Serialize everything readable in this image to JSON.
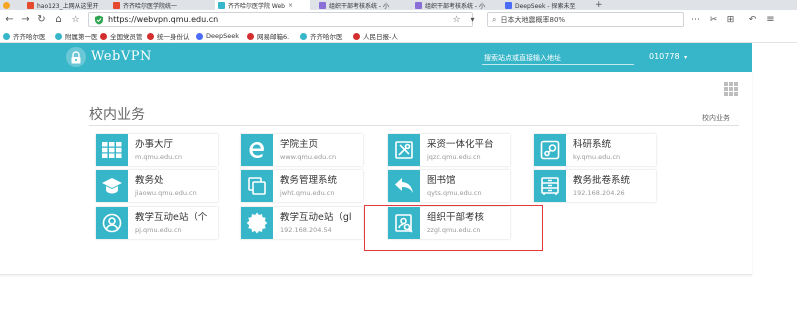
{
  "tabs": [
    {
      "label": "hao123_上网从这里开",
      "color": "#e64a2e"
    },
    {
      "label": "齐齐哈尔医学院统一",
      "color": "#e64a2e"
    },
    {
      "label": "齐齐哈尔医学院 Web",
      "color": "#38b6c9"
    },
    {
      "label": "组织干部考核系统 - 小",
      "color": "#8a6fd8"
    },
    {
      "label": "组织干部考核系统 - 小",
      "color": "#8a6fd8"
    },
    {
      "label": "DeepSeek - 探索未至",
      "color": "#4a6cf7"
    }
  ],
  "nav": {
    "url": "https://webvpn.qmu.edu.cn",
    "search": "日本大地震概率80%"
  },
  "bookmarks": [
    {
      "label": "齐齐哈尔医",
      "color": "#38b6c9"
    },
    {
      "label": "附属第一医",
      "color": "#38b6c9"
    },
    {
      "label": "全国党员管",
      "color": "#d32f2f"
    },
    {
      "label": "统一身份认",
      "color": "#d32f2f"
    },
    {
      "label": "DeepSeek",
      "color": "#4a6cf7"
    },
    {
      "label": "网易邮箱6.",
      "color": "#d32f2f"
    },
    {
      "label": "齐齐哈尔医",
      "color": "#38b6c9"
    },
    {
      "label": "人民日报-人",
      "color": "#d32f2f"
    }
  ],
  "header": {
    "brand": "WebVPN",
    "search_placeholder": "搜索站点或直接输入地址",
    "user": "010778"
  },
  "section": {
    "title": "校内业务",
    "side_link": "校内业务"
  },
  "colors": {
    "accent": "#38b6c9",
    "highlight": "#e23a3a"
  },
  "apps": [
    {
      "name": "办事大厅",
      "domain": "m.qmu.edu.cn",
      "icon": "grid-icon"
    },
    {
      "name": "学院主页",
      "domain": "www.qmu.edu.cn",
      "icon": "browser-e-icon"
    },
    {
      "name": "采资一体化平台",
      "domain": "jqzc.qmu.edu.cn",
      "icon": "tools-icon"
    },
    {
      "name": "科研系统",
      "domain": "ky.qmu.edu.cn",
      "icon": "steam-icon"
    },
    {
      "name": "教务处",
      "domain": "jiaowu.qmu.edu.cn",
      "icon": "graduation-cap-icon"
    },
    {
      "name": "教务管理系统",
      "domain": "jwht.qmu.edu.cn",
      "icon": "copy-icon"
    },
    {
      "name": "图书馆",
      "domain": "qyts.qmu.edu.cn",
      "icon": "reply-icon"
    },
    {
      "name": "教务批卷系统",
      "domain": "192.168.204.26",
      "icon": "cabinet-icon"
    },
    {
      "name": "教学互动e站（个",
      "domain": "pj.qmu.edu.cn",
      "icon": "user-circle-icon"
    },
    {
      "name": "教学互动e站（gl",
      "domain": "192.168.204.54",
      "icon": "gear-badge-icon"
    },
    {
      "name": "组织干部考核",
      "domain": "zzgl.qmu.edu.cn",
      "icon": "user-search-icon"
    }
  ]
}
